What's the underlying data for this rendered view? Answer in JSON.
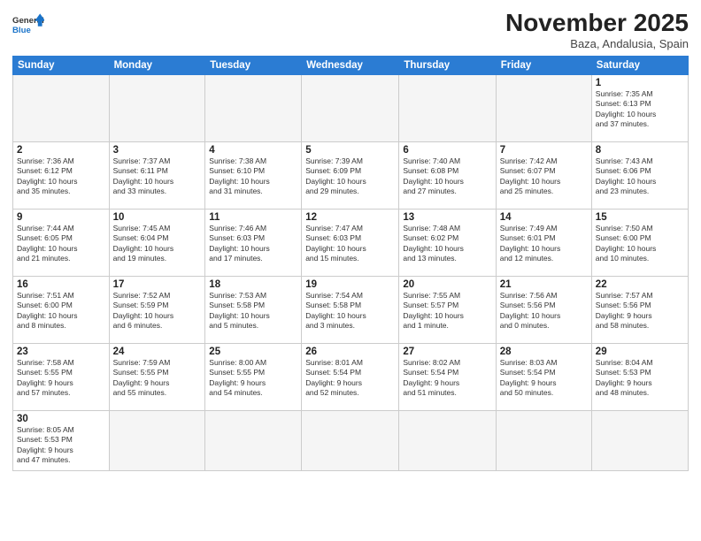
{
  "logo": {
    "line1": "General",
    "line2": "Blue"
  },
  "title": "November 2025",
  "subtitle": "Baza, Andalusia, Spain",
  "weekdays": [
    "Sunday",
    "Monday",
    "Tuesday",
    "Wednesday",
    "Thursday",
    "Friday",
    "Saturday"
  ],
  "weeks": [
    [
      {
        "day": "",
        "info": ""
      },
      {
        "day": "",
        "info": ""
      },
      {
        "day": "",
        "info": ""
      },
      {
        "day": "",
        "info": ""
      },
      {
        "day": "",
        "info": ""
      },
      {
        "day": "",
        "info": ""
      },
      {
        "day": "1",
        "info": "Sunrise: 7:35 AM\nSunset: 6:13 PM\nDaylight: 10 hours\nand 37 minutes."
      }
    ],
    [
      {
        "day": "2",
        "info": "Sunrise: 7:36 AM\nSunset: 6:12 PM\nDaylight: 10 hours\nand 35 minutes."
      },
      {
        "day": "3",
        "info": "Sunrise: 7:37 AM\nSunset: 6:11 PM\nDaylight: 10 hours\nand 33 minutes."
      },
      {
        "day": "4",
        "info": "Sunrise: 7:38 AM\nSunset: 6:10 PM\nDaylight: 10 hours\nand 31 minutes."
      },
      {
        "day": "5",
        "info": "Sunrise: 7:39 AM\nSunset: 6:09 PM\nDaylight: 10 hours\nand 29 minutes."
      },
      {
        "day": "6",
        "info": "Sunrise: 7:40 AM\nSunset: 6:08 PM\nDaylight: 10 hours\nand 27 minutes."
      },
      {
        "day": "7",
        "info": "Sunrise: 7:42 AM\nSunset: 6:07 PM\nDaylight: 10 hours\nand 25 minutes."
      },
      {
        "day": "8",
        "info": "Sunrise: 7:43 AM\nSunset: 6:06 PM\nDaylight: 10 hours\nand 23 minutes."
      }
    ],
    [
      {
        "day": "9",
        "info": "Sunrise: 7:44 AM\nSunset: 6:05 PM\nDaylight: 10 hours\nand 21 minutes."
      },
      {
        "day": "10",
        "info": "Sunrise: 7:45 AM\nSunset: 6:04 PM\nDaylight: 10 hours\nand 19 minutes."
      },
      {
        "day": "11",
        "info": "Sunrise: 7:46 AM\nSunset: 6:03 PM\nDaylight: 10 hours\nand 17 minutes."
      },
      {
        "day": "12",
        "info": "Sunrise: 7:47 AM\nSunset: 6:03 PM\nDaylight: 10 hours\nand 15 minutes."
      },
      {
        "day": "13",
        "info": "Sunrise: 7:48 AM\nSunset: 6:02 PM\nDaylight: 10 hours\nand 13 minutes."
      },
      {
        "day": "14",
        "info": "Sunrise: 7:49 AM\nSunset: 6:01 PM\nDaylight: 10 hours\nand 12 minutes."
      },
      {
        "day": "15",
        "info": "Sunrise: 7:50 AM\nSunset: 6:00 PM\nDaylight: 10 hours\nand 10 minutes."
      }
    ],
    [
      {
        "day": "16",
        "info": "Sunrise: 7:51 AM\nSunset: 6:00 PM\nDaylight: 10 hours\nand 8 minutes."
      },
      {
        "day": "17",
        "info": "Sunrise: 7:52 AM\nSunset: 5:59 PM\nDaylight: 10 hours\nand 6 minutes."
      },
      {
        "day": "18",
        "info": "Sunrise: 7:53 AM\nSunset: 5:58 PM\nDaylight: 10 hours\nand 5 minutes."
      },
      {
        "day": "19",
        "info": "Sunrise: 7:54 AM\nSunset: 5:58 PM\nDaylight: 10 hours\nand 3 minutes."
      },
      {
        "day": "20",
        "info": "Sunrise: 7:55 AM\nSunset: 5:57 PM\nDaylight: 10 hours\nand 1 minute."
      },
      {
        "day": "21",
        "info": "Sunrise: 7:56 AM\nSunset: 5:56 PM\nDaylight: 10 hours\nand 0 minutes."
      },
      {
        "day": "22",
        "info": "Sunrise: 7:57 AM\nSunset: 5:56 PM\nDaylight: 9 hours\nand 58 minutes."
      }
    ],
    [
      {
        "day": "23",
        "info": "Sunrise: 7:58 AM\nSunset: 5:55 PM\nDaylight: 9 hours\nand 57 minutes."
      },
      {
        "day": "24",
        "info": "Sunrise: 7:59 AM\nSunset: 5:55 PM\nDaylight: 9 hours\nand 55 minutes."
      },
      {
        "day": "25",
        "info": "Sunrise: 8:00 AM\nSunset: 5:55 PM\nDaylight: 9 hours\nand 54 minutes."
      },
      {
        "day": "26",
        "info": "Sunrise: 8:01 AM\nSunset: 5:54 PM\nDaylight: 9 hours\nand 52 minutes."
      },
      {
        "day": "27",
        "info": "Sunrise: 8:02 AM\nSunset: 5:54 PM\nDaylight: 9 hours\nand 51 minutes."
      },
      {
        "day": "28",
        "info": "Sunrise: 8:03 AM\nSunset: 5:54 PM\nDaylight: 9 hours\nand 50 minutes."
      },
      {
        "day": "29",
        "info": "Sunrise: 8:04 AM\nSunset: 5:53 PM\nDaylight: 9 hours\nand 48 minutes."
      }
    ],
    [
      {
        "day": "30",
        "info": "Sunrise: 8:05 AM\nSunset: 5:53 PM\nDaylight: 9 hours\nand 47 minutes."
      },
      {
        "day": "",
        "info": ""
      },
      {
        "day": "",
        "info": ""
      },
      {
        "day": "",
        "info": ""
      },
      {
        "day": "",
        "info": ""
      },
      {
        "day": "",
        "info": ""
      },
      {
        "day": "",
        "info": ""
      }
    ]
  ]
}
